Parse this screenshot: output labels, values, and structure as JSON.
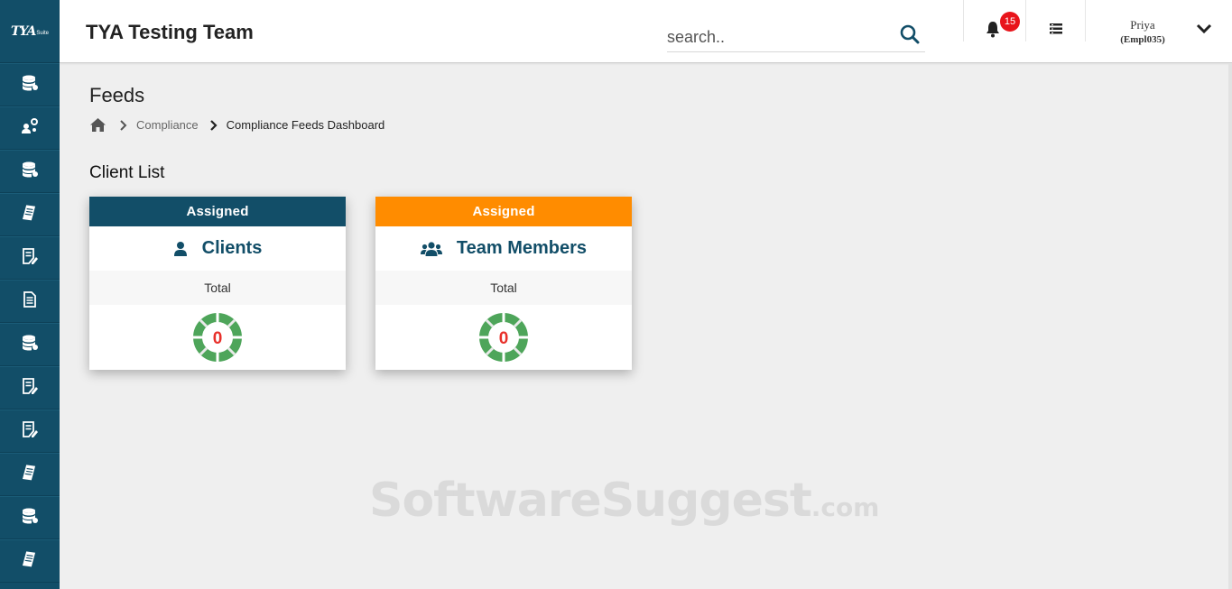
{
  "sidebar": {
    "logo_text": "TYA",
    "logo_sub": "Suite",
    "items": [
      {
        "icon": "database-icon"
      },
      {
        "icon": "user-config-icon"
      },
      {
        "icon": "database-icon"
      },
      {
        "icon": "document-stack-icon"
      },
      {
        "icon": "document-edit-icon"
      },
      {
        "icon": "document-icon"
      },
      {
        "icon": "database-icon"
      },
      {
        "icon": "document-edit-icon"
      },
      {
        "icon": "document-edit-icon"
      },
      {
        "icon": "document-stack-icon"
      },
      {
        "icon": "database-icon"
      },
      {
        "icon": "document-stack-icon"
      }
    ]
  },
  "header": {
    "title": "TYA Testing Team",
    "search_placeholder": "search..",
    "notification_count": "15",
    "user_name": "Priya",
    "user_id": "(Empl035)"
  },
  "page": {
    "title": "Feeds",
    "breadcrumb": {
      "parent": "Compliance",
      "current": "Compliance Feeds Dashboard"
    },
    "section_title": "Client List"
  },
  "cards": [
    {
      "header": "Assigned",
      "header_color": "#124e68",
      "title": "Clients",
      "icon": "user-icon",
      "subtitle": "Total",
      "value": "0"
    },
    {
      "header": "Assigned",
      "header_color": "#ff8c00",
      "title": "Team Members",
      "icon": "users-icon",
      "subtitle": "Total",
      "value": "0"
    }
  ],
  "colors": {
    "sidebar": "#124e68",
    "accent_dark": "#124e68",
    "accent_orange": "#ff8c00",
    "ring_green": "#4ea55a",
    "value_red": "#e8302a",
    "badge_red": "#e8141b"
  },
  "watermark": {
    "main": "SoftwareSuggest",
    "suffix": ".com"
  }
}
